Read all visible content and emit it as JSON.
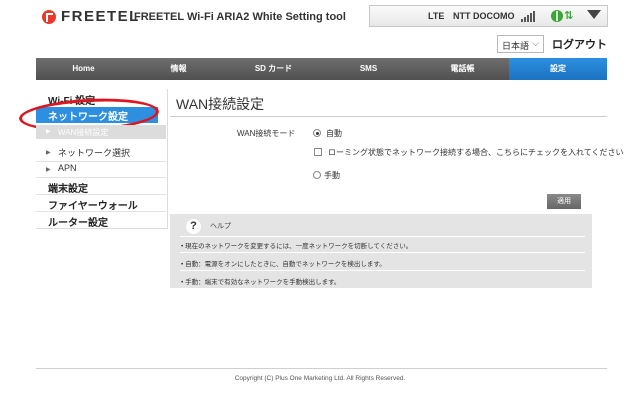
{
  "header": {
    "brand": "FREETEL",
    "app_title": "FREETEL Wi-Fi ARIA2 White Setting tool",
    "status": {
      "network_type": "LTE",
      "carrier": "NTT DOCOMO",
      "signal_icon": "signal-bars-icon",
      "connection_icon": "globe-icon",
      "data_icon": "data-arrows-icon",
      "arrows_glyph": "⇅",
      "wifi_icon": "wifi-icon"
    },
    "language": "日本語",
    "logout": "ログアウト"
  },
  "nav": {
    "items": [
      {
        "label": "Home"
      },
      {
        "label": "情報"
      },
      {
        "label": "SD カード"
      },
      {
        "label": "SMS"
      },
      {
        "label": "電話帳"
      },
      {
        "label": "設定"
      }
    ],
    "active": "設定",
    "active_color": "#2e8fe0"
  },
  "sidebar": {
    "wifi": "Wi-Fi 設定",
    "network": "ネットワーク設定",
    "wan": "WAN接続設定",
    "network_select": "ネットワーク選択",
    "apn": "APN",
    "device": "端末設定",
    "firewall": "ファイヤーウォール",
    "router": "ルーター設定",
    "highlight_color": "#e0141e"
  },
  "main": {
    "title": "WAN接続設定",
    "mode_label": "WAN接続モード",
    "auto_label": "自動",
    "roaming_label": "ローミング状態でネットワーク接続する場合、こちらにチェックを入れてください",
    "manual_label": "手動",
    "selected_mode": "自動",
    "roaming_checked": false,
    "apply_label": "適用"
  },
  "help": {
    "icon_glyph": "?",
    "title": "ヘルプ",
    "lines": [
      "• 現在のネットワークを変更するには、一度ネットワークを切断してください。",
      "• 自動：電源をオンにしたときに、自動でネットワークを検出します。",
      "• 手動：端末で有効なネットワークを手動検出します。"
    ]
  },
  "footer": {
    "copyright": "Copyright (C) Plus One Marketing Ltd. All Rights Reserved."
  }
}
